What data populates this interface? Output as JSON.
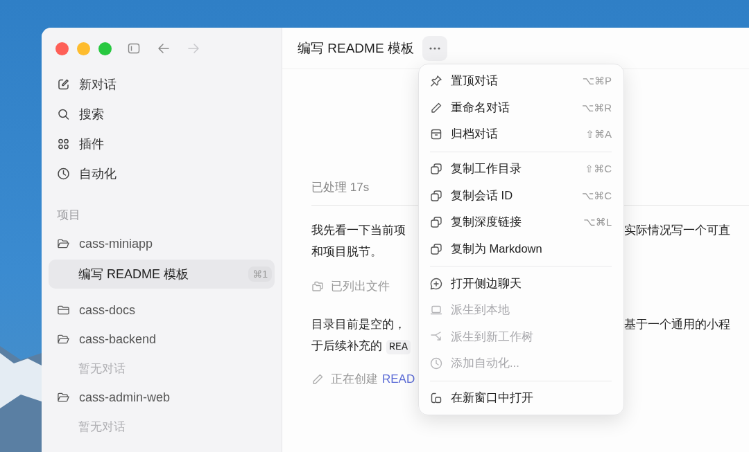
{
  "sidebar": {
    "nav_buttons": [
      {
        "disabled": false
      },
      {
        "disabled": true
      }
    ],
    "nav": [
      {
        "label": "新对话"
      },
      {
        "label": "搜索"
      },
      {
        "label": "插件"
      },
      {
        "label": "自动化"
      }
    ],
    "projects_heading": "项目",
    "projects": [
      {
        "name": "cass-miniapp",
        "expanded": true,
        "chats": [
          {
            "title": "编写 README 模板",
            "shortcut": "⌘1",
            "selected": true
          }
        ]
      },
      {
        "name": "cass-docs",
        "expanded": false
      },
      {
        "name": "cass-backend",
        "expanded": true,
        "empty_note": "暂无对话"
      },
      {
        "name": "cass-admin-web",
        "expanded": true,
        "empty_note": "暂无对话"
      }
    ]
  },
  "main": {
    "title": "编写 README 模板",
    "status": "已处理 17s",
    "blocks": [
      {
        "kind": "paragraph",
        "lines": [
          {
            "text": "我先看一下当前项",
            "right": "实际情况写一个可直"
          },
          {
            "text": "和项目脱节。"
          }
        ]
      },
      {
        "kind": "listed",
        "text": "已列出文件"
      },
      {
        "kind": "paragraph",
        "lines": [
          {
            "text": "目录目前是空的，",
            "right": "基于一个通用的小程"
          },
          {
            "text": "于后续补充的",
            "code": "REA"
          }
        ]
      },
      {
        "kind": "editing",
        "text": "正在创建",
        "link": "READ"
      }
    ]
  },
  "menu": {
    "groups": [
      [
        {
          "label": "置顶对话",
          "shortcut": "⌥⌘P",
          "disabled": false
        },
        {
          "label": "重命名对话",
          "shortcut": "⌥⌘R",
          "disabled": false
        },
        {
          "label": "归档对话",
          "shortcut": "⇧⌘A",
          "disabled": false
        }
      ],
      [
        {
          "label": "复制工作目录",
          "shortcut": "⇧⌘C",
          "disabled": false
        },
        {
          "label": "复制会话 ID",
          "shortcut": "⌥⌘C",
          "disabled": false
        },
        {
          "label": "复制深度链接",
          "shortcut": "⌥⌘L",
          "disabled": false
        },
        {
          "label": "复制为 Markdown",
          "disabled": false
        }
      ],
      [
        {
          "label": "打开侧边聊天",
          "disabled": false
        },
        {
          "label": "派生到本地",
          "disabled": true
        },
        {
          "label": "派生到新工作树",
          "disabled": true
        },
        {
          "label": "添加自动化...",
          "disabled": true
        }
      ],
      [
        {
          "label": "在新窗口中打开",
          "disabled": false
        }
      ]
    ]
  }
}
